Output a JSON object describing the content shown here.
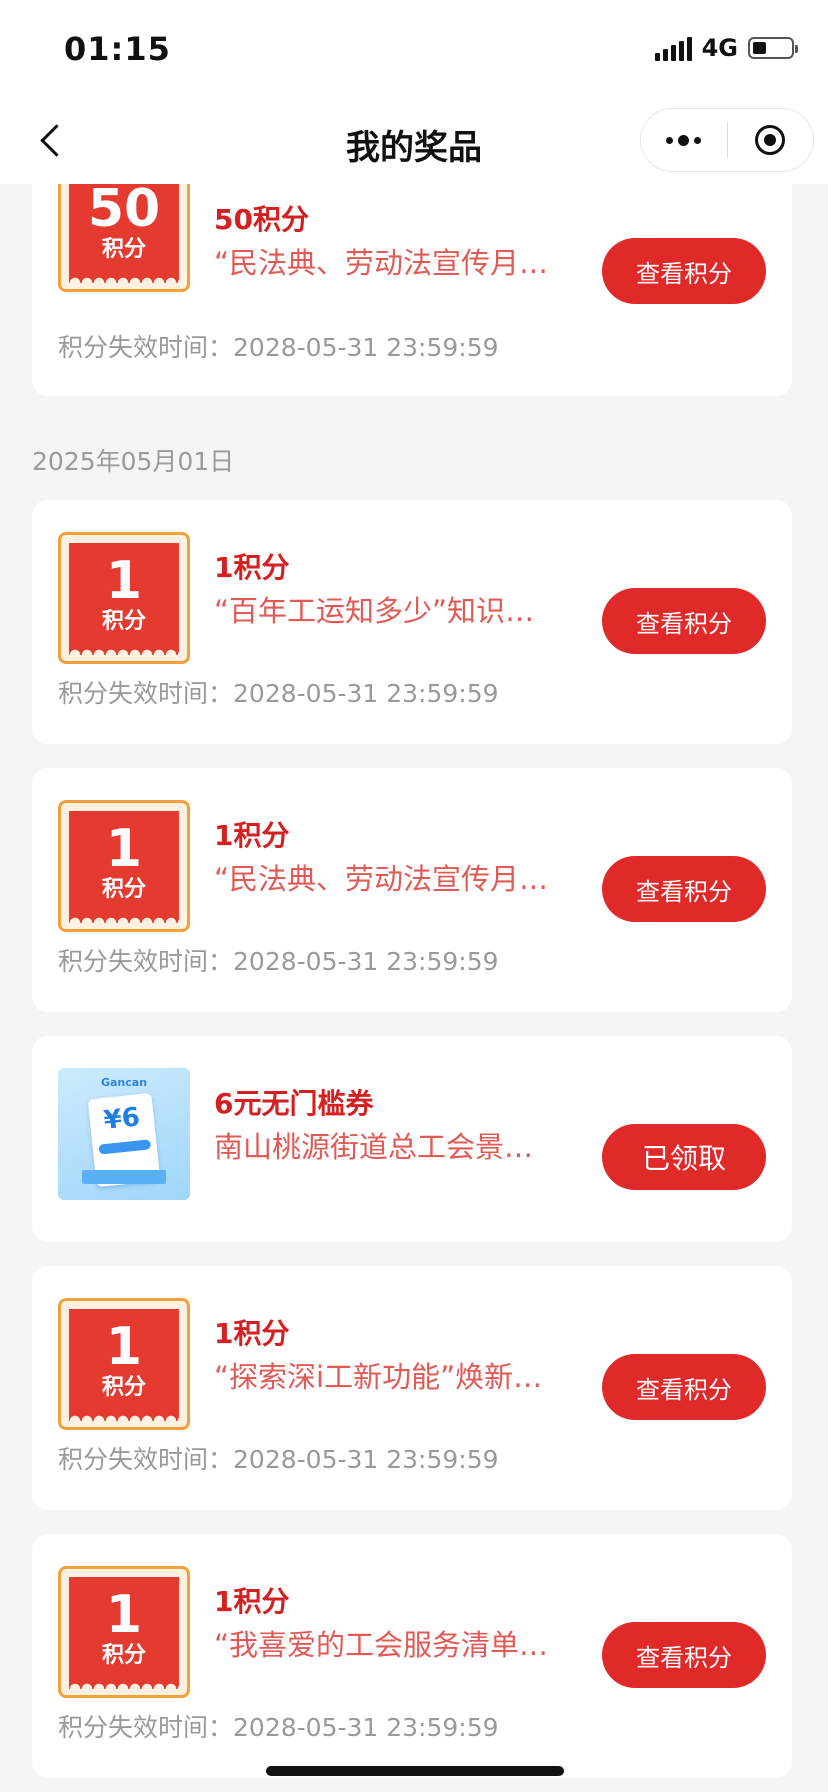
{
  "status_bar": {
    "time": "01:15",
    "network": "4G",
    "battery_level": 0.35
  },
  "nav": {
    "title": "我的奖品"
  },
  "groups": [
    {
      "date": "2025年05月01日"
    }
  ],
  "prizes": [
    {
      "badge_num": "50",
      "badge_unit": "积分",
      "name": "50积分",
      "desc": "“民法典、劳动法宣传月”知识竞答活动",
      "button": "查看积分",
      "expire_label": "积分失效时间：",
      "expire_time": "2028-05-31 23:59:59"
    },
    {
      "badge_num": "1",
      "badge_unit": "积分",
      "name": "1积分",
      "desc": "“百年工运知多少”知识竞答活动",
      "button": "查看积分",
      "expire_label": "积分失效时间：",
      "expire_time": "2028-05-31 23:59:59"
    },
    {
      "badge_num": "1",
      "badge_unit": "积分",
      "name": "1积分",
      "desc": "“民法典、劳动法宣传月”知识竞答活动",
      "button": "查看积分",
      "expire_label": "积分失效时间：",
      "expire_time": "2028-05-31 23:59:59"
    },
    {
      "coupon_value": "¥6",
      "coupon_logo": "Gancan",
      "name": "6元无门槛券",
      "desc": "南山桃源街道总工会景田活动",
      "button": "已领取"
    },
    {
      "badge_num": "1",
      "badge_unit": "积分",
      "name": "1积分",
      "desc": "“探索深i工新功能”焕新打卡活动",
      "button": "查看积分",
      "expire_label": "积分失效时间：",
      "expire_time": "2028-05-31 23:59:59"
    },
    {
      "badge_num": "1",
      "badge_unit": "积分",
      "name": "1积分",
      "desc": "“我喜爱的工会服务清单”投票活动",
      "button": "查看积分",
      "expire_label": "积分失效时间：",
      "expire_time": "2028-05-31 23:59:59"
    }
  ],
  "colors": {
    "accent": "#e02a2a",
    "name_red": "#d42020",
    "desc_red": "#e25a55",
    "badge_border": "#f2a03a",
    "page_bg": "#f5f5f5"
  }
}
